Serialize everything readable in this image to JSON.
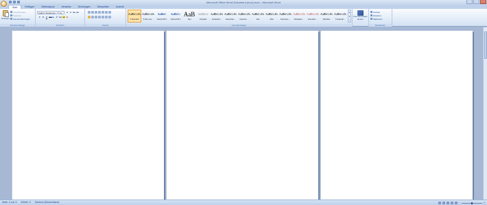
{
  "window": {
    "title": "Microsoft Office Word-Dokument (neu).docx - Microsoft Word",
    "controls": [
      "minimize-icon",
      "maximize-icon",
      "close-icon"
    ]
  },
  "office_button": {
    "icon": "office-logo-icon"
  },
  "quick_access": [
    "save-icon",
    "undo-icon",
    "redo-icon"
  ],
  "tabs": [
    {
      "label": "Start",
      "active": true
    },
    {
      "label": "Einfügen"
    },
    {
      "label": "Seitenlayout"
    },
    {
      "label": "Verweise"
    },
    {
      "label": "Sendungen"
    },
    {
      "label": "Überprüfen"
    },
    {
      "label": "Ansicht"
    }
  ],
  "ribbon": {
    "clipboard": {
      "label": "Zwischenablage",
      "paste_label": "Einfügen",
      "items": [
        "Ausschneiden",
        "Kopieren",
        "Format übertragen"
      ]
    },
    "font": {
      "label": "Schriftart",
      "font_name": "Calibri (Textkörper)",
      "font_size": "11",
      "buttons_row1": [
        "A",
        "A",
        "Aa",
        "ab"
      ],
      "buttons_row2": [
        "F",
        "K",
        "U",
        "abc",
        "x₂",
        "x²",
        "Aa",
        "ab",
        "A"
      ]
    },
    "paragraph": {
      "label": "Absatz"
    },
    "styles": {
      "label": "Formatvorlagen",
      "items": [
        {
          "sample": "AaBbCcDc",
          "name": "¶ Standard",
          "active": true
        },
        {
          "sample": "AaBbCcDc",
          "name": "¶ Kein Lee..."
        },
        {
          "sample": "AaBbC",
          "name": "Überschrift 1",
          "kind": "head"
        },
        {
          "sample": "AaBbCc",
          "name": "Überschrift 2",
          "kind": "head"
        },
        {
          "sample": "AaB",
          "name": "Titel",
          "kind": "big"
        },
        {
          "sample": "AaBbCcl",
          "name": "Untertitel",
          "kind": "gray"
        },
        {
          "sample": "AaBbCcDc",
          "name": "Schwache..."
        },
        {
          "sample": "AaBbCcDc",
          "name": "Hervorheb..."
        },
        {
          "sample": "AaBbCcDc",
          "name": "Intensive ..."
        },
        {
          "sample": "AaBbCcDc",
          "name": "Fett"
        },
        {
          "sample": "AaBbCcDc",
          "name": "Zitat"
        },
        {
          "sample": "AaBbCcDc",
          "name": "Intensives ..."
        },
        {
          "sample": "AaBbCcDc",
          "name": "Schwache ...",
          "kind": "red"
        },
        {
          "sample": "AaBbCcDc",
          "name": "Intensiver ...",
          "kind": "red"
        },
        {
          "sample": "AaBbCcDc",
          "name": "Buchtitel"
        },
        {
          "sample": "AaBbCcDc",
          "name": "¶ Listenab..."
        }
      ],
      "change_label": "Formatvorlagen ändern"
    },
    "editing": {
      "label": "Bearbeiten",
      "items": [
        "Suchen",
        "Ersetzen",
        "Markieren"
      ]
    }
  },
  "status": {
    "page": "Seite: 3 von 3",
    "words": "Wörter: 0",
    "language": "Deutsch (Deutschland)"
  }
}
